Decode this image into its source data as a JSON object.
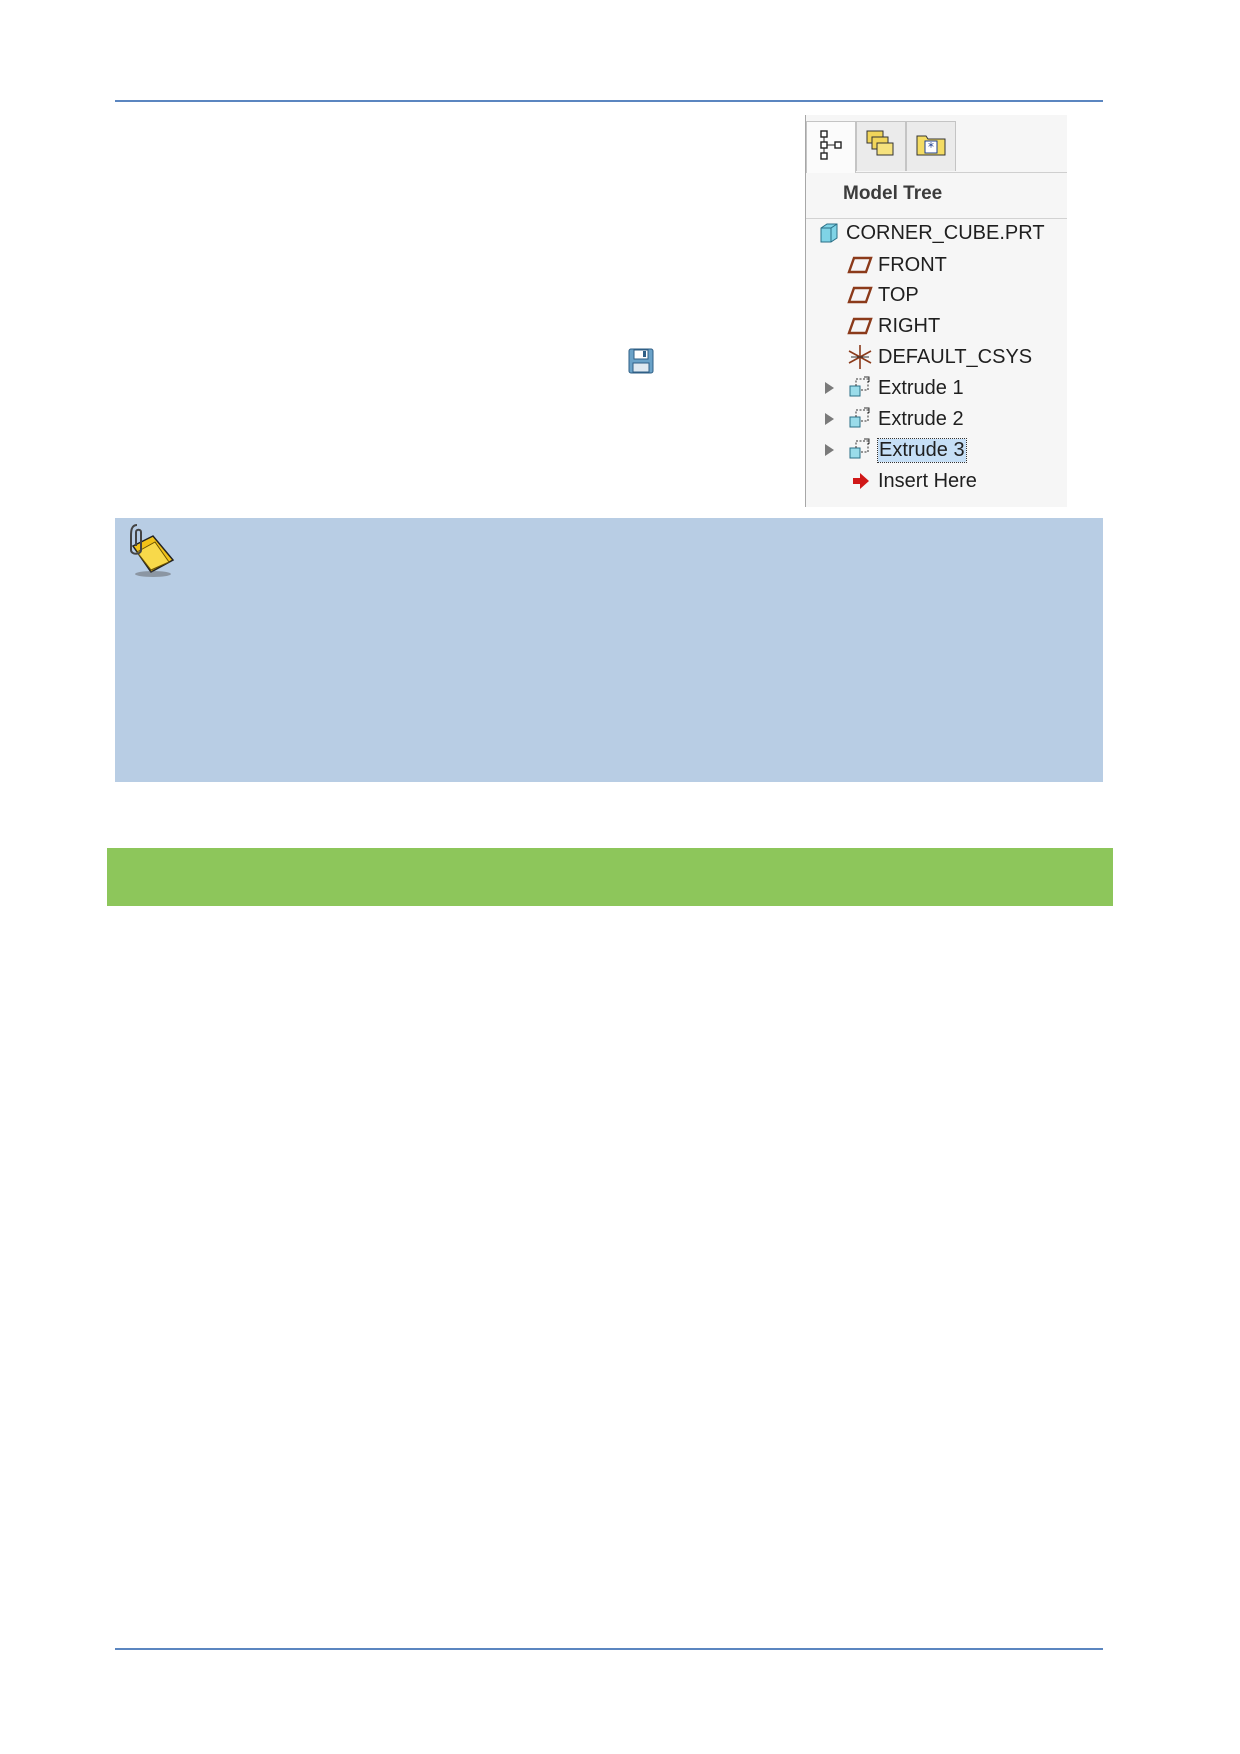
{
  "model_tree": {
    "tabs": [
      {
        "icon": "model-tree-tab-icon",
        "active": true
      },
      {
        "icon": "layers-tab-icon",
        "active": false
      },
      {
        "icon": "favorites-folder-tab-icon",
        "active": false
      }
    ],
    "title": "Model Tree",
    "root": {
      "label": "CORNER_CUBE.PRT",
      "icon": "part-cube-icon"
    },
    "items": [
      {
        "label": "FRONT",
        "icon": "datum-plane-icon"
      },
      {
        "label": "TOP",
        "icon": "datum-plane-icon"
      },
      {
        "label": "RIGHT",
        "icon": "datum-plane-icon"
      },
      {
        "label": "DEFAULT_CSYS",
        "icon": "coordinate-system-icon"
      },
      {
        "label": "Extrude 1",
        "icon": "extrude-icon",
        "expandable": true
      },
      {
        "label": "Extrude 2",
        "icon": "extrude-icon",
        "expandable": true
      },
      {
        "label": "Extrude 3",
        "icon": "extrude-icon",
        "expandable": true,
        "selected": true
      },
      {
        "label": "Insert Here",
        "icon": "insert-here-arrow-icon"
      }
    ]
  },
  "colors": {
    "rule": "#5b86c0",
    "note_background": "#b8cde4",
    "section_bar": "#8dc65b",
    "selection": "#c6dff6",
    "datum_plane": "#8b3a1a",
    "part_cube": "#7fd3e6",
    "insert_arrow": "#d01818"
  },
  "icons": {
    "save": "save-floppy-icon",
    "note": "note-paperclip-icon"
  }
}
